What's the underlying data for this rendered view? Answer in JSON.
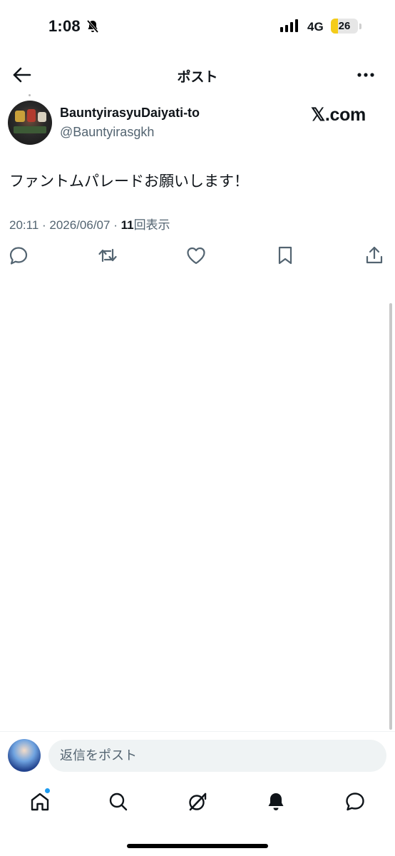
{
  "status_bar": {
    "time": "1:08",
    "network": "4G",
    "battery_level": "26",
    "battery_fraction": 0.26,
    "battery_color": "#f4cc1a"
  },
  "header": {
    "title": "ポスト"
  },
  "post": {
    "author": {
      "display_name": "BauntyirasyuDaiyati-to",
      "handle": "@Bauntyirasgkh"
    },
    "watermark": "𝕏.com",
    "text": "ファントムパレードお願いします！",
    "time": "20:11 · 2026/06/07 · ",
    "views_count": "11",
    "views_label": "回表示",
    "actions": [
      "reply",
      "repost",
      "like",
      "bookmark",
      "share"
    ]
  },
  "composer": {
    "placeholder": "返信をポスト"
  },
  "tab_bar": {
    "items": [
      "home",
      "search",
      "grok",
      "notifications",
      "messages"
    ]
  },
  "colors": {
    "text_primary": "#0f1419",
    "text_secondary": "#536471",
    "accent": "#1d9bf0"
  }
}
